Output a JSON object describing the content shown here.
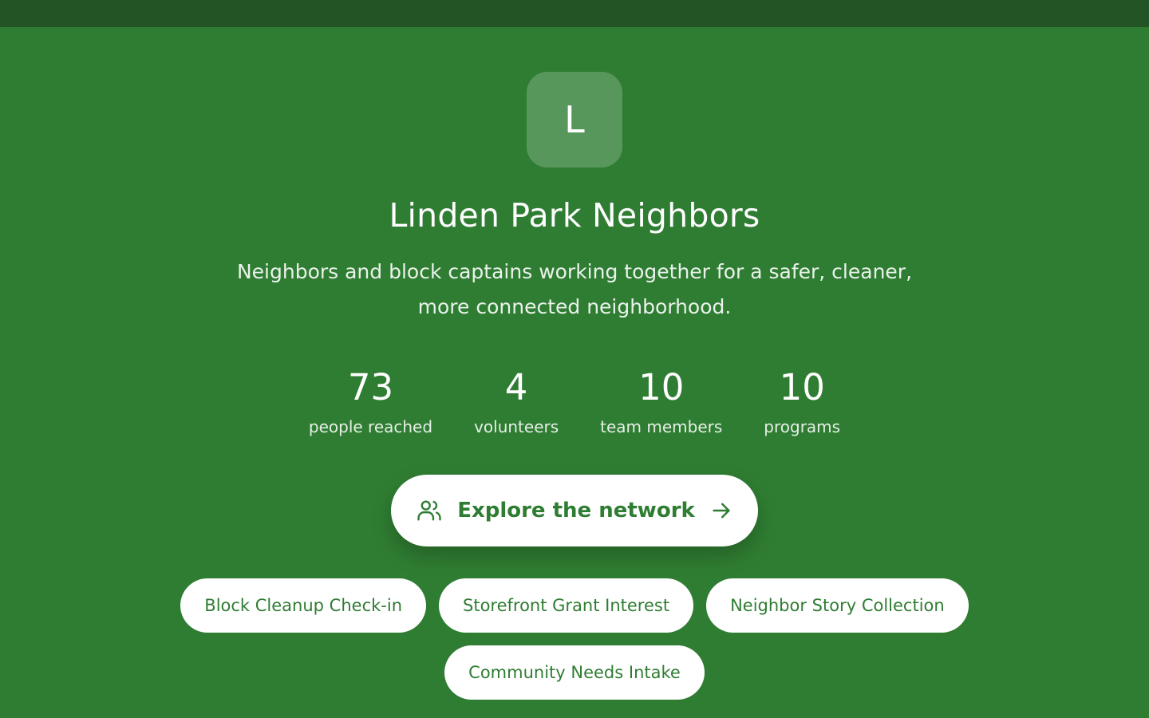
{
  "org": {
    "initial": "L",
    "name": "Linden Park Neighbors",
    "tagline": "Neighbors and block captains working together for a safer, cleaner, more connected neighborhood."
  },
  "stats": [
    {
      "value": "73",
      "label": "people reached"
    },
    {
      "value": "4",
      "label": "volunteers"
    },
    {
      "value": "10",
      "label": "team members"
    },
    {
      "value": "10",
      "label": "programs"
    }
  ],
  "cta": {
    "label": "Explore the network",
    "icon": "people-icon",
    "trailing_icon": "arrow-right-icon"
  },
  "programs": [
    {
      "label": "Block Cleanup Check-in"
    },
    {
      "label": "Storefront Grant Interest"
    },
    {
      "label": "Neighbor Story Collection"
    },
    {
      "label": "Community Needs Intake"
    }
  ],
  "colors": {
    "background": "#2f7d32",
    "topbar": "#235425",
    "accent_text": "#2f7d32",
    "surface": "#ffffff"
  }
}
